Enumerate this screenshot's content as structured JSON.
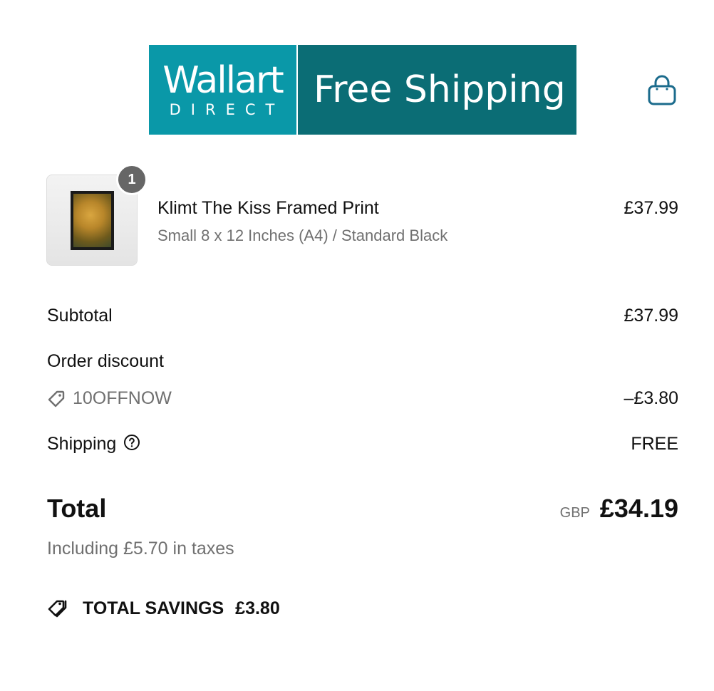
{
  "banner": {
    "brand_name": "Wallart",
    "brand_sub": "DIRECT",
    "promo": "Free Shipping",
    "colors": {
      "brand_bg": "#0a98a8",
      "promo_bg": "#0b6d75"
    }
  },
  "cart": {
    "icon": "shopping-bag-icon",
    "color": "#1b6b8c"
  },
  "line_item": {
    "quantity": "1",
    "title": "Klimt The Kiss Framed Print",
    "variant": "Small 8 x 12 Inches (A4) / Standard Black",
    "price": "£37.99"
  },
  "summary": {
    "subtotal_label": "Subtotal",
    "subtotal_value": "£37.99",
    "discount_label": "Order discount",
    "discount_code": "10OFFNOW",
    "discount_value": "–£3.80",
    "shipping_label": "Shipping",
    "shipping_value": "FREE",
    "total_label": "Total",
    "currency": "GBP",
    "total_value": "£34.19",
    "tax_note": "Including £5.70 in taxes",
    "savings_label": "TOTAL SAVINGS",
    "savings_value": "£3.80"
  }
}
